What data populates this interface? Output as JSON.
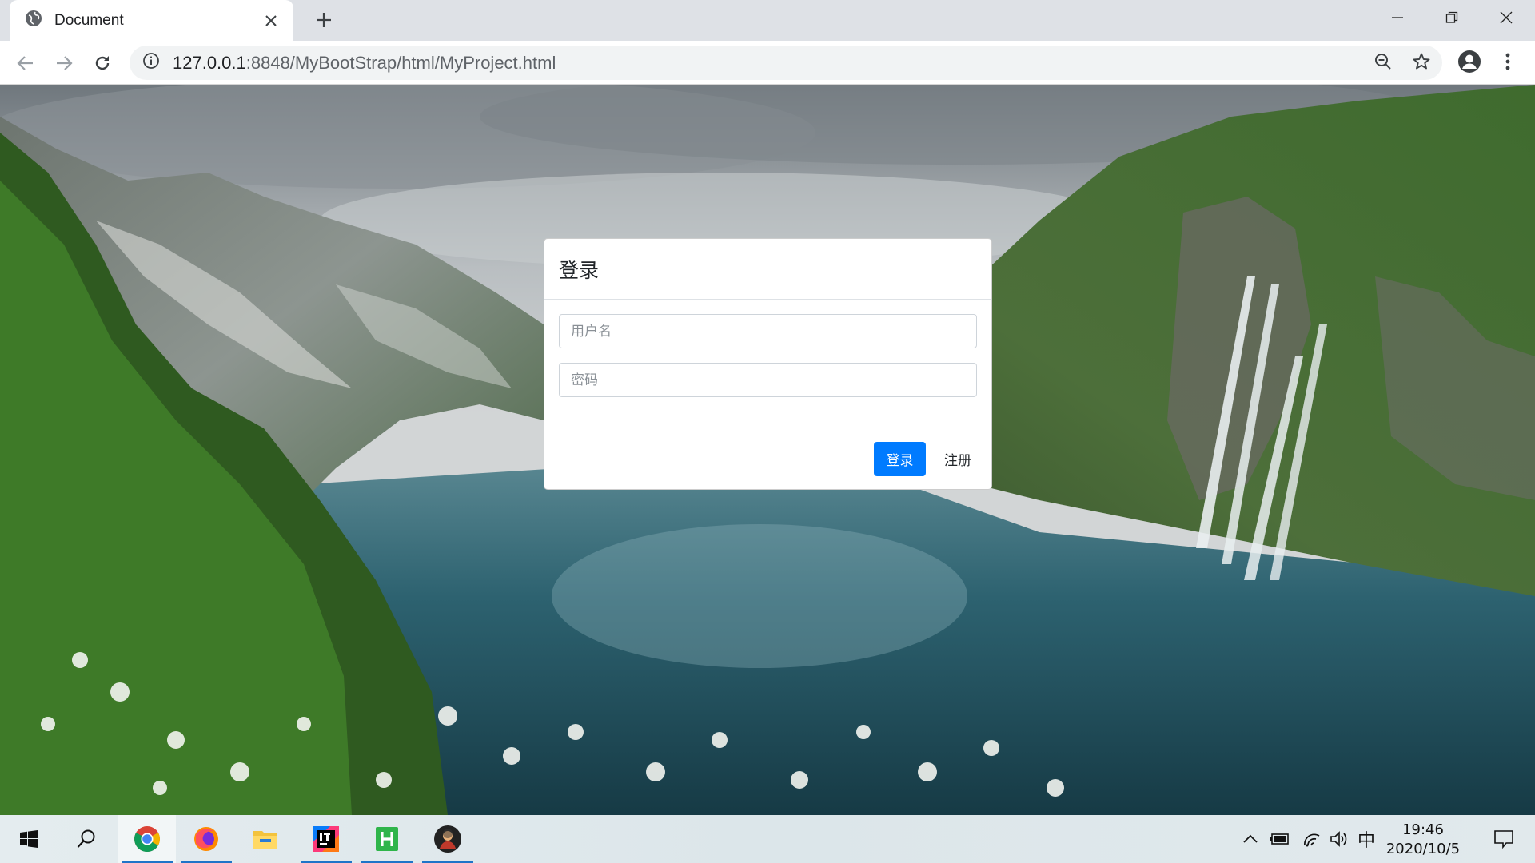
{
  "browser": {
    "tab_title": "Document",
    "url_host": "127.0.0.1",
    "url_path": ":8848/MyBootStrap/html/MyProject.html"
  },
  "modal": {
    "title": "登录",
    "username_placeholder": "用户名",
    "password_placeholder": "密码",
    "login_button": "登录",
    "register_button": "注册"
  },
  "taskbar": {
    "apps": [
      "start-icon",
      "search-icon",
      "chrome-icon",
      "firefox-icon",
      "file-explorer-icon",
      "intellij-icon",
      "hbuilder-icon",
      "app-avatar-icon"
    ],
    "ime_label": "中",
    "time": "19:46",
    "date": "2020/10/5"
  },
  "colors": {
    "primary": "#007bff",
    "taskbar_accent": "#1e74c8"
  }
}
